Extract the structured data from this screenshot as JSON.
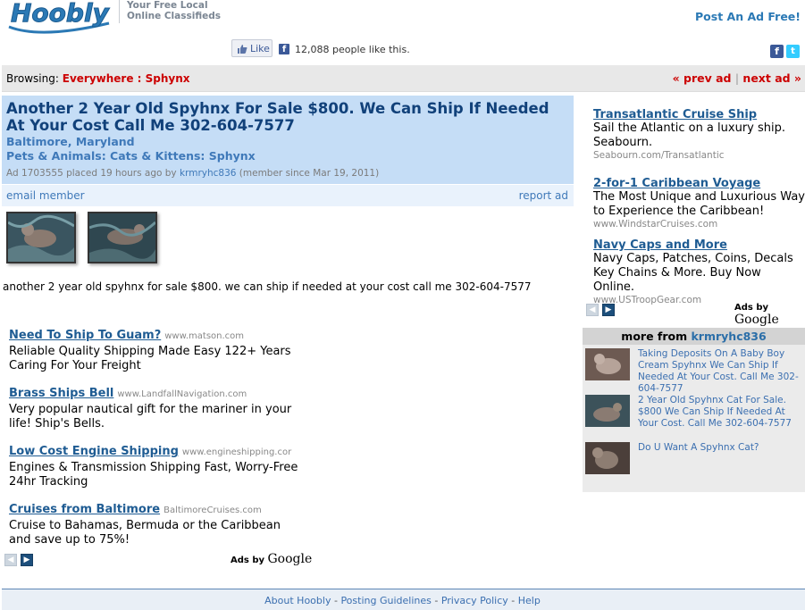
{
  "header": {
    "logo_text": "Hoobly",
    "tagline_line1": "Your Free Local",
    "tagline_line2": "Online Classifieds",
    "post_ad": "Post An Ad Free!",
    "like_label": "Like",
    "like_count_text": "12,088 people like this."
  },
  "browse": {
    "label": "Browsing:",
    "location": "Everywhere : Sphynx",
    "prev": "« prev ad",
    "sep": "|",
    "next": "next ad »"
  },
  "ad": {
    "title": "Another 2 Year Old Spyhnx For Sale $800. We Can Ship If Needed At Your Cost Call Me 302-604-7577",
    "location": "Baltimore, Maryland",
    "category": "Pets & Animals: Cats & Kittens: Sphynx",
    "meta_prefix": "Ad 1703555 placed 19 hours ago by",
    "user": "krmryhc836",
    "meta_suffix": "(member since Mar 19, 2011)",
    "email_member": "email member",
    "report_ad": "report ad",
    "description": "another 2 year old spyhnx for sale $800. we can ship if needed at your cost call me 302-604-7577"
  },
  "left_ads": [
    {
      "title": "Need To Ship To Guam?",
      "url": "www.matson.com",
      "body": "Reliable Quality Shipping Made Easy 122+ Years Caring For Your Freight"
    },
    {
      "title": "Brass Ships Bell",
      "url": "www.LandfallNavigation.com",
      "body": "Very popular nautical gift for the mariner in your life! Ship's Bells."
    },
    {
      "title": "Low Cost Engine Shipping",
      "url": "www.engineshipping.cor",
      "body": "Engines & Transmission Shipping Fast, Worry-Free 24hr Tracking"
    },
    {
      "title": "Cruises from Baltimore",
      "url": "BaltimoreCruises.com",
      "body": "Cruise to Bahamas, Bermuda or the Caribbean and save up to 75%!"
    }
  ],
  "right_ads": [
    {
      "title": "Transatlantic Cruise Ship",
      "body": "Sail the Atlantic on a luxury ship. Seabourn.",
      "url": "Seabourn.com/Transatlantic"
    },
    {
      "title": "2-for-1 Caribbean Voyage",
      "body": "The Most Unique and Luxurious Way to Experience the Caribbean!",
      "url": "www.WindstarCruises.com"
    },
    {
      "title": "Navy Caps and More",
      "body": "Navy Caps, Patches, Coins, Decals Key Chains & More. Buy Now Online.",
      "url": "www.USTroopGear.com"
    }
  ],
  "ads_by": "Ads by",
  "google": "Google",
  "more_from": {
    "label": "more from",
    "user": "krmryhc836",
    "items": [
      "Taking Deposits On A Baby Boy Cream Spyhnx We Can Ship If Needed At Your Cost. Call Me 302-604-7577",
      "2 Year Old Spyhnx Cat For Sale. $800 We Can Ship If Needed At Your Cost. Call Me 302-604-7577",
      "Do U Want A Spyhnx Cat?"
    ]
  },
  "footer": {
    "about": "About Hoobly",
    "sep1": " - ",
    "guidelines": "Posting Guidelines",
    "sep2": " - ",
    "privacy": "Privacy Policy",
    "sep3": " - ",
    "help": "Help"
  }
}
